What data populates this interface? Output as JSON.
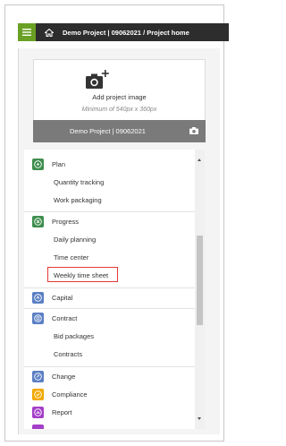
{
  "header": {
    "breadcrumb": "Demo Project | 09062021  /  Project home"
  },
  "project_image": {
    "add_label": "Add project image",
    "min_size": "Minimum of 540px x 360px",
    "project_name": "Demo Project | 09062021"
  },
  "menu": {
    "plan": {
      "label": "Plan",
      "items": [
        "Quantity tracking",
        "Work packaging"
      ]
    },
    "progress": {
      "label": "Progress",
      "items": [
        "Daily planning",
        "Time center",
        "Weekly time sheet"
      ]
    },
    "capital": {
      "label": "Capital"
    },
    "contract": {
      "label": "Contract",
      "items": [
        "Bid packages",
        "Contracts"
      ]
    },
    "change": {
      "label": "Change"
    },
    "compliance": {
      "label": "Compliance"
    },
    "report": {
      "label": "Report"
    }
  },
  "colors": {
    "menu_green": "#6aa023",
    "plan_icon": "#3e8e4e",
    "progress_icon": "#3e8e4e",
    "capital_icon": "#5b7fc4",
    "contract_icon": "#5b7fc4",
    "change_icon": "#5b7fc4",
    "compliance_icon": "#f2a900",
    "report_icon": "#a43fc8",
    "highlight": "#e53935"
  }
}
